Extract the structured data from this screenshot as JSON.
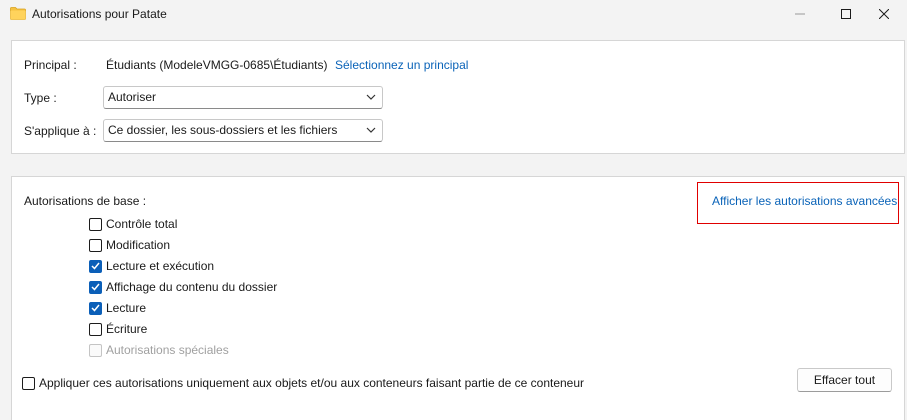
{
  "window": {
    "title": "Autorisations pour Patate",
    "folder_icon": "folder-icon",
    "controls": [
      "minimize-icon",
      "maximize-icon",
      "close-icon"
    ]
  },
  "principal": {
    "label": "Principal :",
    "value": "Étudiants (ModeleVMGG-0685\\Étudiants)",
    "select_link": "Sélectionnez un principal"
  },
  "type": {
    "label": "Type :",
    "selected": "Autoriser"
  },
  "applies_to": {
    "label": "S'applique à :",
    "selected": "Ce dossier, les sous-dossiers et les fichiers"
  },
  "basic": {
    "title": "Autorisations de base :",
    "advanced_link": "Afficher les autorisations avancées",
    "items": [
      {
        "label": "Contrôle total",
        "checked": false,
        "disabled": false
      },
      {
        "label": "Modification",
        "checked": false,
        "disabled": false
      },
      {
        "label": "Lecture et exécution",
        "checked": true,
        "disabled": false
      },
      {
        "label": "Affichage du contenu du dossier",
        "checked": true,
        "disabled": false
      },
      {
        "label": "Lecture",
        "checked": true,
        "disabled": false
      },
      {
        "label": "Écriture",
        "checked": false,
        "disabled": false
      },
      {
        "label": "Autorisations spéciales",
        "checked": false,
        "disabled": true
      }
    ]
  },
  "apply_only": {
    "label": "Appliquer ces autorisations uniquement aux objets et/ou aux conteneurs faisant partie de ce conteneur",
    "checked": false
  },
  "clear_all_label": "Effacer tout",
  "colors": {
    "accent": "#0b5fb8",
    "link": "#0a63b8",
    "highlight": "#e00000"
  }
}
